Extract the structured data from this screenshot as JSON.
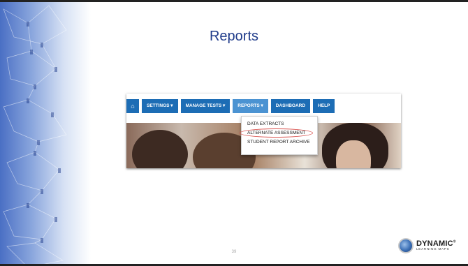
{
  "slide": {
    "title": "Reports",
    "page_number": "39"
  },
  "navbar": {
    "home_icon": "home-icon",
    "items": [
      {
        "label": "SETTINGS ▾"
      },
      {
        "label": "MANAGE TESTS ▾"
      },
      {
        "label": "REPORTS ▾",
        "active": true
      },
      {
        "label": "DASHBOARD"
      },
      {
        "label": "HELP"
      }
    ]
  },
  "dropdown": {
    "items": [
      {
        "label": "DATA EXTRACTS"
      },
      {
        "label": "ALTERNATE ASSESSMENT",
        "highlighted": true
      },
      {
        "label": "STUDENT REPORT ARCHIVE"
      }
    ]
  },
  "logo": {
    "name": "DYNAMIC",
    "mark": "®",
    "subtitle": "LEARNING MAPS"
  },
  "colors": {
    "title": "#1f3b8a",
    "nav": "#1d6db5",
    "nav_active": "#4b93d2",
    "highlight_ring": "#d9534f"
  }
}
